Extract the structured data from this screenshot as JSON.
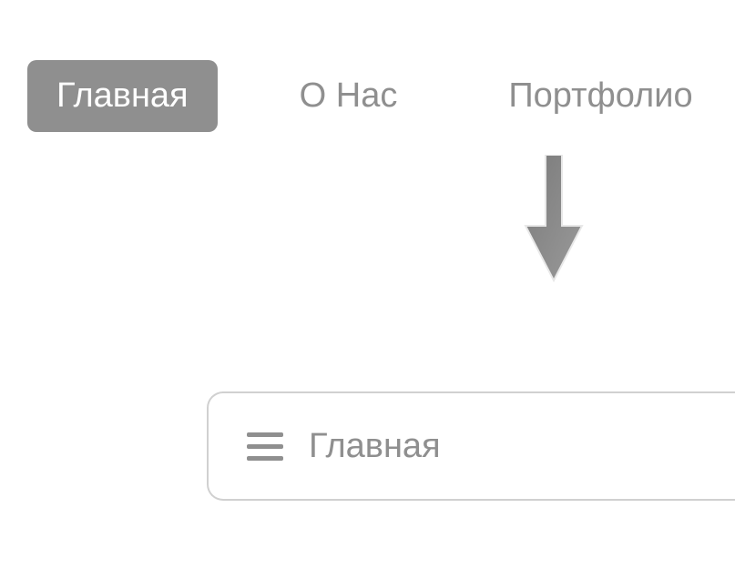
{
  "nav": {
    "items": [
      {
        "label": "Главная",
        "active": true
      },
      {
        "label": "О Нас",
        "active": false
      },
      {
        "label": "Портфолио",
        "active": false
      }
    ]
  },
  "mobile_nav": {
    "current_label": "Главная"
  }
}
